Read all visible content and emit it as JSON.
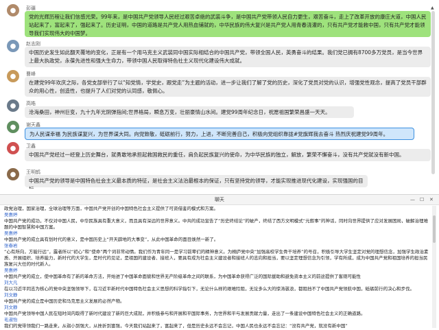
{
  "chat": {
    "messages": [
      {
        "sender": "彭疆",
        "style": "green",
        "text": "党的光辉历程让我们信感光荣。99年来，是中国共产党领导人民经过艰苦卓绝的武装斗争，是中国共产党带领人民自力更生，艰苦奋斗，走上了改革开放的康庄大道，中国人民站起来了，富起来了，强起来了。历史证明，中国的道路是共产党人用热血铺就的，中华民族的伟大复兴是共产党人用青春浇灌的，只有共产党才能救中国，只有共产党才能领导我们实现伟大的中国梦。"
      },
      {
        "sender": "赵志刚",
        "style": "gray",
        "text": "中国历史发生如此翻天覆地的变化，正是有一个用马克主义武装同中国实际相结合的中国共产党，带领全国人民，英勇奋斗的结果。我们党已拥有8700多万党员，是当今世界上最大执政党，永葆先进性和强大生命力，带领中国人民取得特色社主义现代化建设伟大成就。"
      },
      {
        "sender": "曹峰",
        "style": "gray",
        "text": "在建党99年欢庆之际，各党支部举行了以“知党情，学党史，跟党走”为主题的活动，进一步让我们了解了党的历史，深化了党员对党的认识，增强党性观念，提高了党员干部群众的用心性，创造性，也提升了人们对党的认同感，敬佩心。"
      },
      {
        "sender": "高皓",
        "style": "gray",
        "text": "沧海桑田，神州巨变，九十九年光阴弹指间;世界格局，瞬息万变，壮丽豪情山水间。建党99周年纪念日，祝愿祖国繁荣昌盛一天天。"
      },
      {
        "sender": "谢天鑫",
        "style": "blue",
        "text": "为人民谋幸福 为民族谋复兴，为世界谋大同。向党致敬，砥砺前行，努力，上进，不断完善自己，积极向党组织靠拢#党旗辉我去奋斗 热烈庆祝建党99周年。"
      },
      {
        "sender": "卫鑫",
        "style": "gray",
        "text": "中国共产党经过一经登上历史舞台，就勇敢地承担起救国救民的重任，肩负起民族复兴的使命，为中华民族的独立，解放，繁荣不懈奋斗，没有共产党就没有新中国。"
      },
      {
        "sender": "王明鹤",
        "style": "gray",
        "text": "中国共产党的领导是中国特色社会主义最本质的特征，是社会主义法治最根本的保证，只有坚持党的领导，才能实现推进现代化建设，实现强国的目标。"
      }
    ]
  },
  "window": {
    "title": "聊天",
    "min_icon": "minimize-icon",
    "max_icon": "maximize-icon",
    "close_icon": "close-icon",
    "log": [
      {
        "name": "",
        "text": "政党治理，国家治理，全球治理等方面，中国共产党开创的中国特色社会主义提供了可资借鉴的模式和方案。"
      },
      {
        "name": "吴惠婷",
        "text": "中国共产党的成功，不仅对中国人民，中华民族具有重大意义，而且具有深远的世界意义。中共的成功宣告了“历史终结论”的破产，终结了西方文明模式“元叙事”的神话，同时向世界提供了应对发展困局，破解治理难题的中国智慧和中国方案。"
      },
      {
        "name": "吴惠婷",
        "text": "中国共产党的成立具有划时代的意义，是中国历史上“开天辟地的大事变”，从此中国革命的面目焕然一新了。"
      },
      {
        "name": "张春岩",
        "text": "“心有所向，方能行远”，露者所以“初心”和“使命”两个词非常动情。我们作为青年同一是学习前辈们的精神意义。为桐庐党中央“加强高校学生骨干培养”的号召，积极引导大学生坚定对党的理想信念，加强学生政治素质、开展组织、培养能力，新时代的大学生，是时代的见证，是祖国的建设者、接班人，要具有成为社会主义建设者和接班人的志向和担当，要以坚定理想信念为引领，学有所成，成为中国共产党和祖国培养的担当民族复兴大任的时代新人。"
      },
      {
        "name": "吴惠婷",
        "text": "中国共产党的成立，使中国革命有了新的革命方法，开始进了中国革命面貌和世界无产阶级革命之间的联系，为中国革命获得广泛的国际援助和避免资本主义的前途提供了客观可能性"
      },
      {
        "name": "刘大凡",
        "text": "在以习近平同志为核心的党中央坚强领导下，在习近平新时代中国特色社会主义思想的科学指引下，无论什么样的艰难险阻，无论多么大的惊涛骇浪，都阻挡不了中国共产党领航中国，砥砺前行的决心和步伐。"
      },
      {
        "name": "刘文静",
        "text": "中国共产党的成立是中国历史和马克思主义发展的必然产物。"
      },
      {
        "name": "刘文静",
        "text": "中国共产党领导中国人民在短时间内取得了新时代建设了新的巨大成就，并积极参与和开展和平国际事务，为世界和平与发展贡献力量，走出了一条建设中国特色社会主义的正确道路。"
      },
      {
        "name": "毛淑怡",
        "text": "我们的党带领我们一路走来，从弱小到强大，从挫折到富强，今天我们站起来了，富起来了，但是历史永远不会忘记，中国人民也永远不会忘记：“没有共产党，就没有新中国”"
      }
    ]
  }
}
